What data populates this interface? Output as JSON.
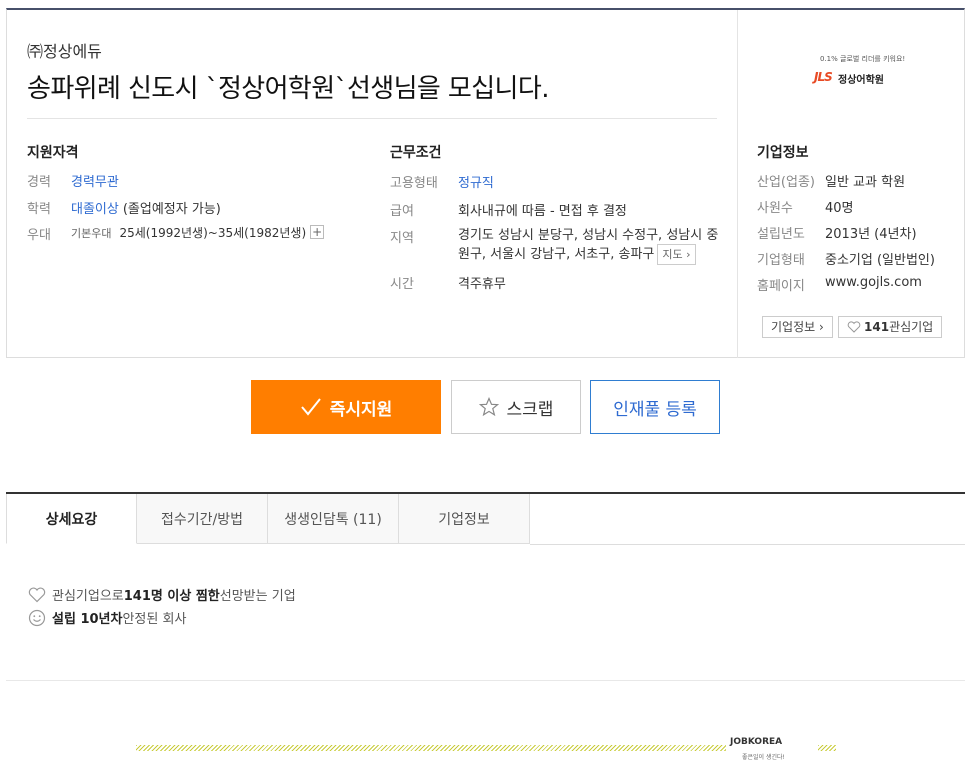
{
  "job": {
    "company": "㈜정상에듀",
    "title": "송파위례 신도시 `정상어학원`선생님을 모십니다."
  },
  "qualifications": {
    "heading": "지원자격",
    "experience_label": "경력",
    "experience_value": "경력무관",
    "education_label": "학력",
    "education_value": "대졸이상",
    "education_note": "(졸업예정자 가능)",
    "preference_label": "우대",
    "preference_sub": "기본우대",
    "preference_value": "25세(1992년생)~35세(1982년생)",
    "more_symbol": "+"
  },
  "conditions": {
    "heading": "근무조건",
    "employment_label": "고용형태",
    "employment_value": "정규직",
    "salary_label": "급여",
    "salary_value": "회사내규에 따름 - 면접 후 결정",
    "location_label": "지역",
    "location_line1": "경기도 성남시 분당구, 성남시 수정구, 성남시 중",
    "location_line2": "원구, 서울시 강남구, 서초구, 송파구",
    "map_label": "지도 ›",
    "time_label": "시간",
    "time_value": "격주휴무"
  },
  "company_info": {
    "logo_tagline": "0.1% 글로벌 리더를 키워요!",
    "logo_mark": "JLS",
    "logo_name": "정상어학원",
    "heading": "기업정보",
    "industry_label": "산업(업종)",
    "industry_value": "일반 교과 학원",
    "employees_label": "사원수",
    "employees_value": "40명",
    "founded_label": "설립년도",
    "founded_value": "2013년 (4년차)",
    "type_label": "기업형태",
    "type_value": "중소기업 (일반법인)",
    "homepage_label": "홈페이지",
    "homepage_value": "www.gojls.com",
    "info_button": "기업정보 ›",
    "interest_count": "141",
    "interest_label": "관심기업"
  },
  "actions": {
    "apply": "즉시지원",
    "scrap": "스크랩",
    "talent_pool": "인재풀 등록"
  },
  "tabs": [
    {
      "label": "상세요강"
    },
    {
      "label": "접수기간/방법"
    },
    {
      "label": "생생인담톡 (11)"
    },
    {
      "label": "기업정보"
    }
  ],
  "features": {
    "f1_pre": "관심기업으로 ",
    "f1_bold": "141명 이상 찜한",
    "f1_post": " 선망받는 기업",
    "f2_bold": "설립 10년차",
    "f2_post": " 안정된 회사"
  },
  "footer": {
    "logo": "JOBKOREA",
    "tagline": "좋은일이 생긴다!"
  },
  "colors": {
    "accent_orange": "#ff7e00",
    "link_blue": "#2f6bd1",
    "stripe": "#c9cc3a"
  },
  "icons": [
    "check-icon",
    "star-icon",
    "heart-icon",
    "smile-icon",
    "chevron-right-icon"
  ]
}
